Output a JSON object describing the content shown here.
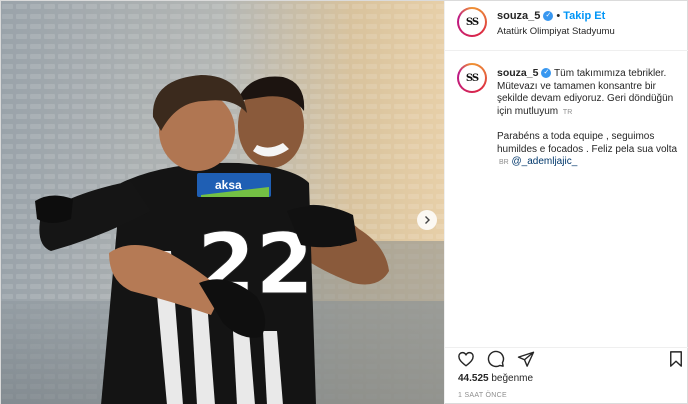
{
  "post": {
    "username": "souza_5",
    "avatar_text": "SS",
    "follow_label": "Takip Et",
    "separator": "•",
    "location": "Atatürk Olimpiyat Stadyumu",
    "caption_line1": "Tüm takımımıza tebrikler. Mütevazı ve tamamen konsantre bir şekilde devam ediyoruz. Geri döndüğün için mutluyum",
    "caption_lang1": "TR",
    "caption_line2": "Parabéns a toda equipe , seguimos humildes e focados . Feliz pela sua volta",
    "caption_lang2": "BR",
    "mention": "@_ademljajic_",
    "likes_count": "44.525",
    "likes_label": "beğenme",
    "time_ago": "1 SAAT ÖNCE",
    "jersey_number": "22",
    "jersey_sponsor": "aksa"
  },
  "colors": {
    "link": "#0095f6",
    "verified": "#3897f0",
    "sponsor_bg": "#1f5fb4",
    "sponsor_stripe": "#74c044"
  },
  "icons": [
    "verified-badge-icon",
    "next-arrow-icon",
    "heart-icon",
    "comment-icon",
    "share-icon",
    "bookmark-icon"
  ]
}
